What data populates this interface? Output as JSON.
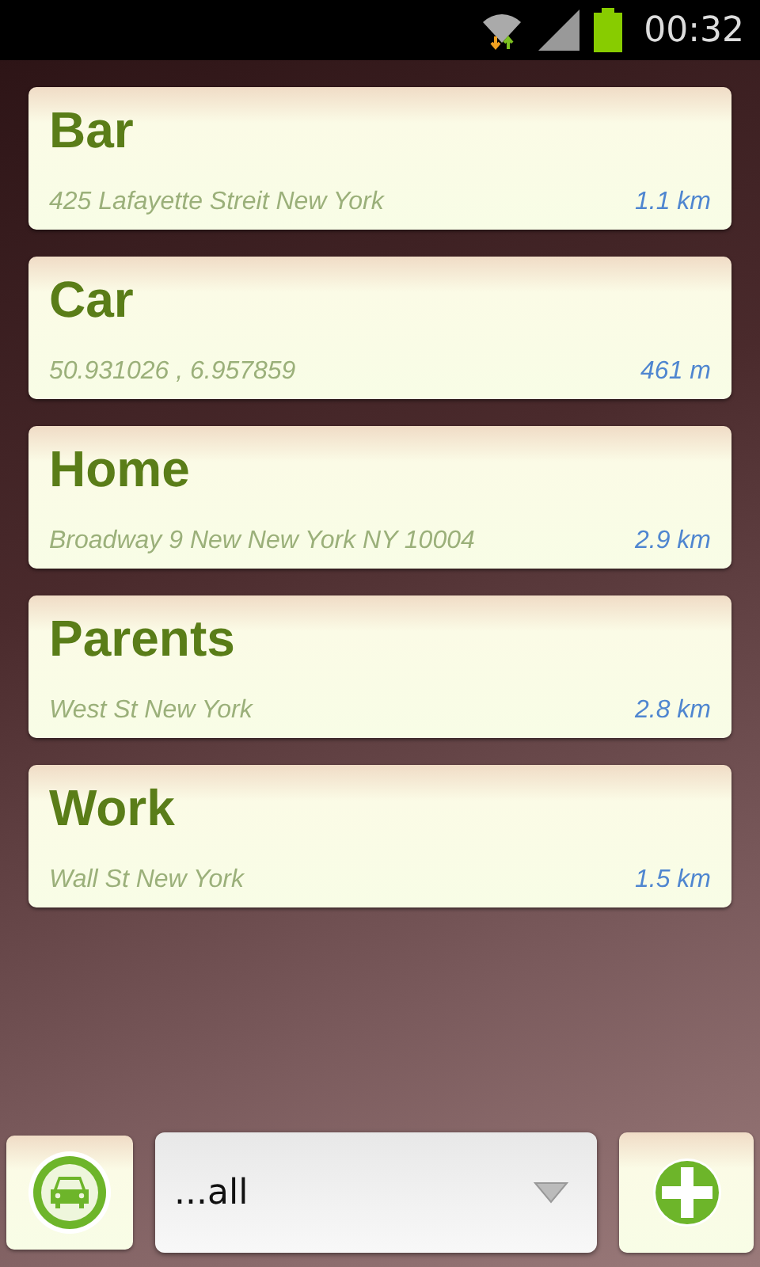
{
  "status_bar": {
    "time": "00:32"
  },
  "places": [
    {
      "name": "Bar",
      "address": "425 Lafayette Streit New York",
      "distance": "1.1 km"
    },
    {
      "name": "Car",
      "address": "50.931026 , 6.957859",
      "distance": "461 m"
    },
    {
      "name": "Home",
      "address": "Broadway 9 New New York NY 10004",
      "distance": "2.9 km"
    },
    {
      "name": "Parents",
      "address": "West St New York",
      "distance": "2.8 km"
    },
    {
      "name": "Work",
      "address": "Wall St New York",
      "distance": "1.5 km"
    }
  ],
  "filter": {
    "value": "...all"
  }
}
